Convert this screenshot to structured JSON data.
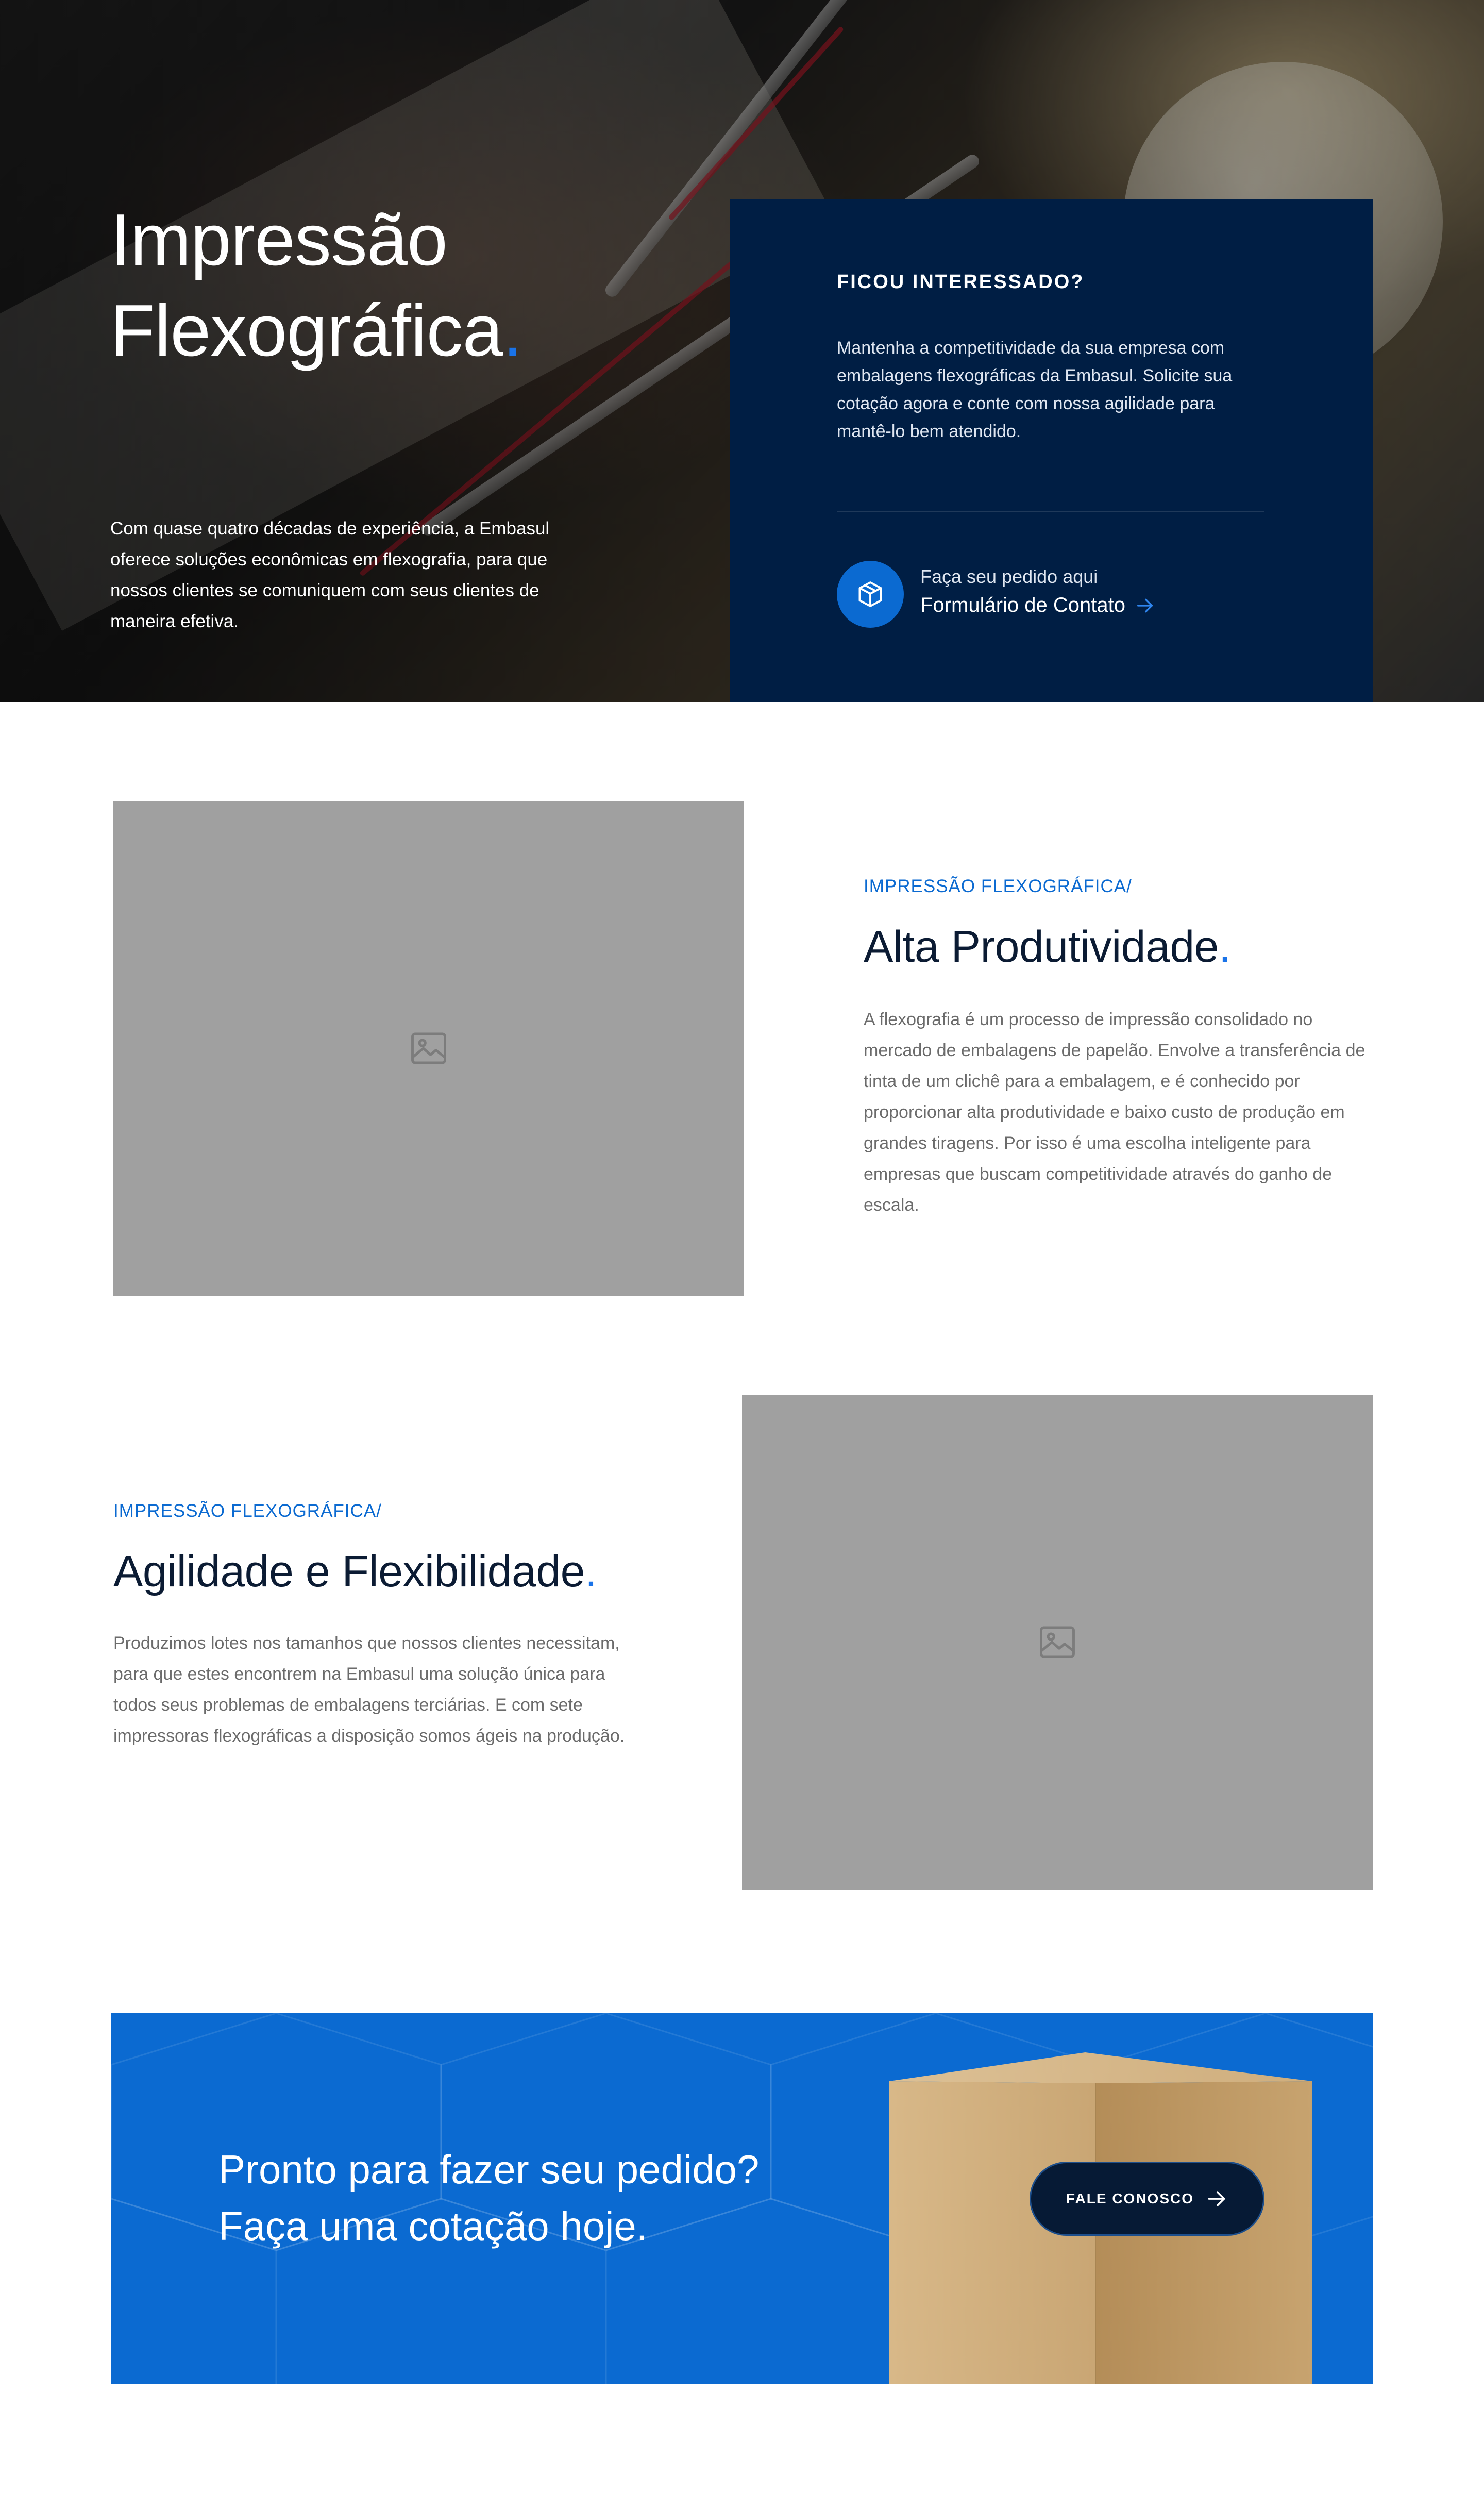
{
  "hero": {
    "title_line1": "Impressão",
    "title_line2": "Flexográfica",
    "title_dot": ".",
    "description": "Com quase quatro décadas de experiência, a Embasul oferece soluções econômicas em flexografia, para que nossos clientes se comuniquem com seus clientes de maneira efetiva."
  },
  "contact_card": {
    "heading": "FICOU INTERESSADO?",
    "text": "Mantenha a competitividade da sua empresa com embalagens flexográficas da Embasul. Solicite sua cotação agora e conte com nossa agilidade para mantê-lo bem atendido.",
    "icon": "package-icon",
    "sub_label": "Faça seu pedido aqui",
    "link_label": "Formulário de Contato",
    "link_icon": "arrow-right-icon"
  },
  "section1": {
    "eyebrow": "IMPRESSÃO FLEXOGRÁFICA/",
    "title": "Alta Produtividade",
    "title_dot": ".",
    "text": "A flexografia é um processo de impressão consolidado no mercado de embalagens de papelão. Envolve a transferência de tinta de um clichê para a embalagem, e é conhecido por proporcionar alta produtividade e baixo custo de produção em grandes tiragens. Por isso é uma escolha inteligente para empresas que buscam competitividade através do ganho de escala.",
    "image_icon": "image-icon"
  },
  "section2": {
    "eyebrow": "IMPRESSÃO FLEXOGRÁFICA/",
    "title": "Agilidade e Flexibilidade",
    "title_dot": ".",
    "text": "Produzimos lotes nos tamanhos que nossos clientes necessitam, para que estes encontrem na Embasul uma solução única para todos seus problemas de embalagens terciárias. E com sete impressoras flexográficas a disposição somos ágeis na produção.",
    "image_icon": "image-icon"
  },
  "cta": {
    "line1": "Pronto para fazer seu pedido?",
    "line2": "Faça uma cotação hoje.",
    "button_label": "FALE CONOSCO",
    "button_icon": "arrow-right-icon"
  },
  "colors": {
    "accent": "#1a73e8",
    "navy": "#001e44",
    "cta_blue": "#0b6ad1",
    "placeholder": "#a0a0a0"
  }
}
